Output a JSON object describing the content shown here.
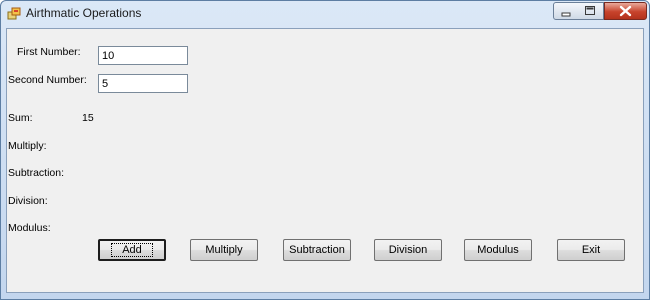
{
  "window": {
    "title": "Airthmatic Operations"
  },
  "form": {
    "first_number_label": "First Number:",
    "first_number_value": "10",
    "second_number_label": "Second Number:",
    "second_number_value": "5"
  },
  "results": {
    "sum_label": "Sum:",
    "sum_value": "15",
    "multiply_label": "Multiply:",
    "subtraction_label": "Subtraction:",
    "division_label": "Division:",
    "modulus_label": "Modulus:"
  },
  "buttons": {
    "add": "Add",
    "multiply": "Multiply",
    "subtraction": "Subtraction",
    "division": "Division",
    "modulus": "Modulus",
    "exit": "Exit"
  }
}
